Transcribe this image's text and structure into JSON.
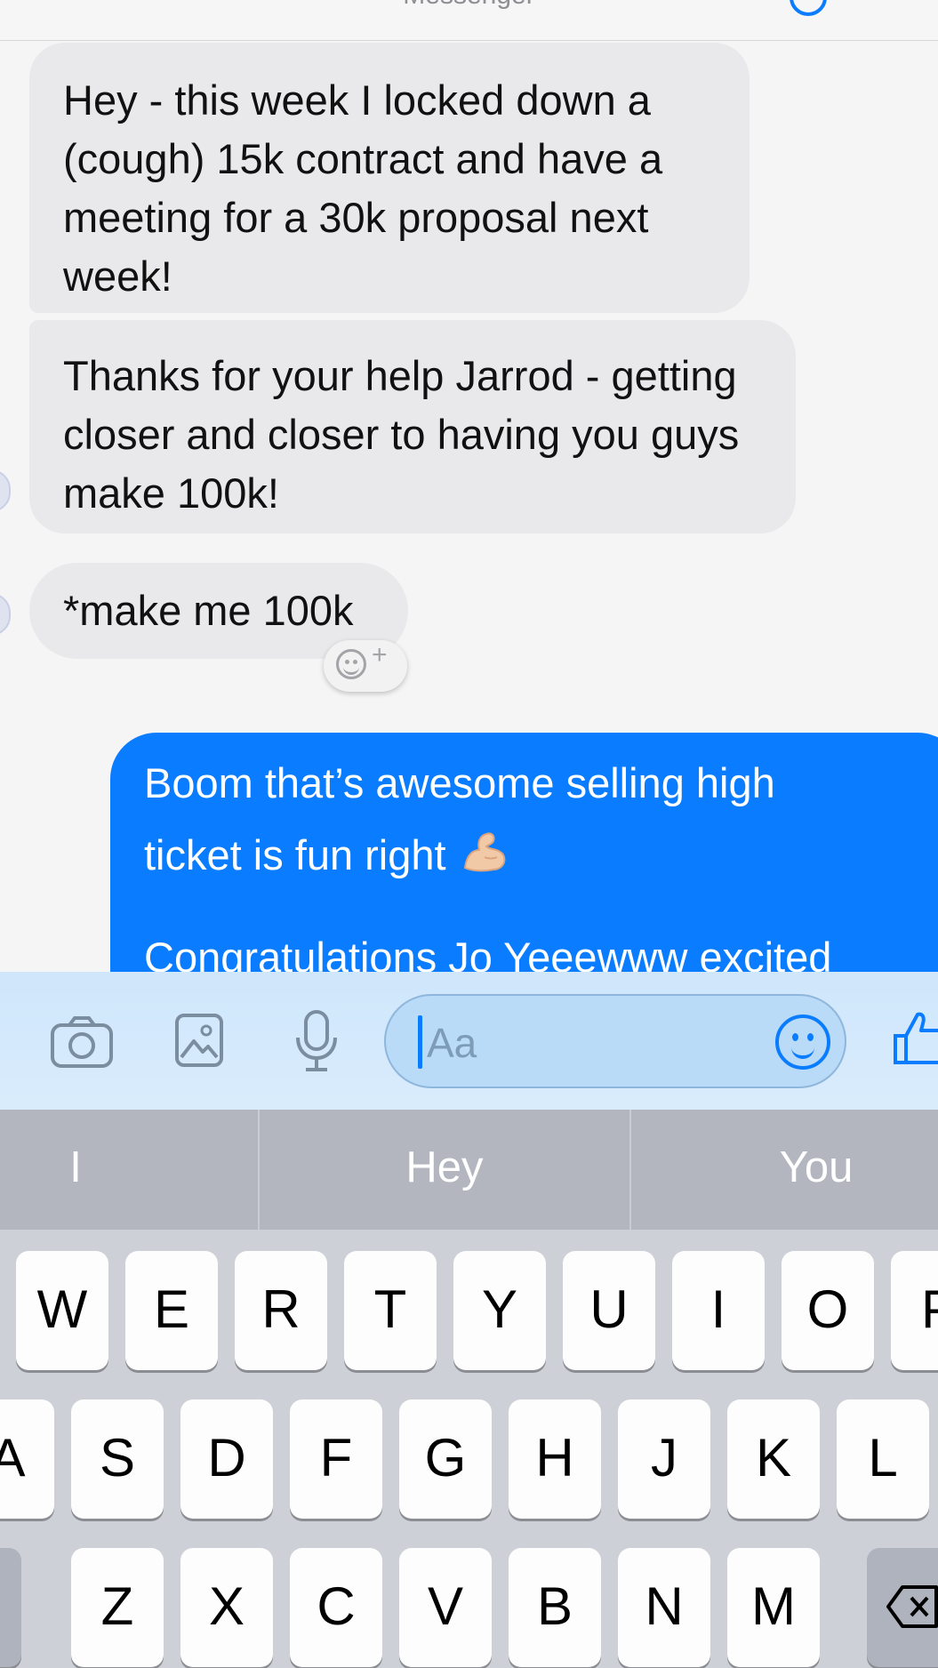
{
  "header": {
    "title": "Messenger"
  },
  "messages": [
    {
      "from": "them",
      "text": "Hey - this week I locked down a (cough) 15k contract and have a meeting for a 30k proposal next week!"
    },
    {
      "from": "them",
      "text": "Thanks for your help Jarrod - getting closer and closer to having you guys make 100k!"
    },
    {
      "from": "them",
      "text": "*make me 100k"
    },
    {
      "from": "me",
      "line1": "Boom that’s awesome selling high",
      "line2": "ticket is fun right",
      "line3": "Congratulations Jo Yeeewww excited"
    }
  ],
  "composer": {
    "placeholder": "Aa",
    "value": ""
  },
  "suggestions": [
    "I",
    "Hey",
    "You"
  ],
  "keyboard": {
    "row1": [
      "W",
      "E",
      "R",
      "T",
      "Y",
      "U",
      "I",
      "O",
      "P"
    ],
    "row2": [
      "A",
      "S",
      "D",
      "F",
      "G",
      "H",
      "J",
      "K",
      "L"
    ],
    "row3": [
      "Z",
      "X",
      "C",
      "V",
      "B",
      "N",
      "M"
    ]
  },
  "colors": {
    "accent": "#0a7cff",
    "bubble_in": "#e9e9eb",
    "composer_bg": "#d2e8fb",
    "keyboard_bg": "#cdd0d6"
  }
}
